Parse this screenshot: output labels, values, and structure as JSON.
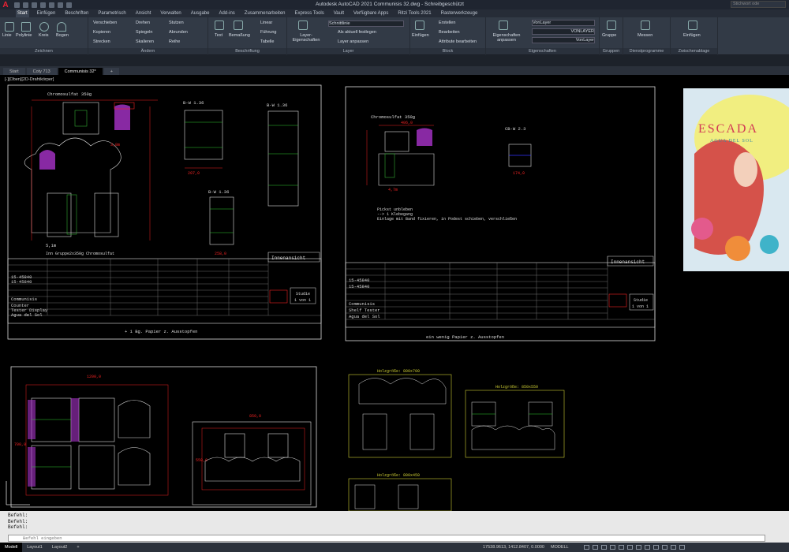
{
  "app": {
    "logo": "A",
    "title": "Autodesk AutoCAD 2021   Communisis 32.dwg - Schreibgeschützt",
    "search_placeholder": "Stichwort ode"
  },
  "ribbon_tabs": [
    "Start",
    "Einfügen",
    "Beschriften",
    "Parametrisch",
    "Ansicht",
    "Verwalten",
    "Ausgabe",
    "Add-ins",
    "Zusammenarbeiten",
    "Express Tools",
    "Vault",
    "Verfügbare Apps",
    "Ritzi Tools 2021",
    "Rasterwerkzeuge"
  ],
  "active_tab": "Start",
  "panels": {
    "zeichnen": {
      "title": "Zeichnen",
      "tools": [
        "Linie",
        "Polylinie",
        "Kreis",
        "Bogen"
      ]
    },
    "aendern": {
      "title": "Ändern",
      "tools": [
        "Verschieben",
        "Drehen",
        "Stutzen",
        "Kopieren",
        "Spiegeln",
        "Abrunden",
        "Strecken",
        "Skalieren",
        "Reihe"
      ]
    },
    "beschriftung": {
      "title": "Beschriftung",
      "tools": [
        "Text",
        "Bemaßung",
        "Linear",
        "Führung",
        "Tabelle"
      ]
    },
    "layer": {
      "title": "Layer",
      "tools": [
        "Layer-Eigenschaften",
        "Schnittlinie",
        "Als aktuell festlegen",
        "Layer anpassen"
      ]
    },
    "block": {
      "title": "Block",
      "tools": [
        "Einfügen",
        "Erstellen",
        "Bearbeiten",
        "Attribute bearbeiten"
      ]
    },
    "eigenschaften": {
      "title": "Eigenschaften",
      "tools": [
        "Eigenschaften anpassen",
        "VonLayer",
        "VONLAYER",
        "VonLayer"
      ]
    },
    "gruppen": {
      "title": "Gruppen",
      "tools": [
        "Gruppe"
      ]
    },
    "dienst": {
      "title": "Dienstprogramme",
      "tools": [
        "Messen"
      ]
    },
    "zwischen": {
      "title": "Zwischenablage",
      "tools": [
        "Einfügen"
      ]
    }
  },
  "doc_tabs": [
    "Start",
    "Coty 713",
    "Communisis 32*"
  ],
  "active_doc_tab": "Communisis 32*",
  "view_label": "[-][Oben][2D-Drahtkörper]",
  "drawing": {
    "sheet1": {
      "title": "Chromosulfat 350g",
      "label_bw1": "B-W 1.36",
      "label_bw2": "B-W 1.36",
      "label_bw3": "B-W 1.36",
      "dim_1": "3,8m",
      "dim_2": "5,1m",
      "dim_w": "207,0",
      "dim_w2": "258,0",
      "footer": "Inn Gruppe2x350g Chromosulfat",
      "view_title": "Innenansicht",
      "study": "Studie",
      "study_no": "1 von 1",
      "note": "+ 1 Bg. Papier z. Ausstopfen",
      "client_rows": [
        "15-45840",
        "15-45840",
        "Communisis",
        "Counter",
        "Tester Display",
        "Agua del Sol"
      ]
    },
    "sheet2": {
      "title": "Chromosulfat 350g",
      "label_cw": "CB-W 2.3",
      "dim_1": "4,7m",
      "dim_w": "406,0",
      "dim_w2": "174,0",
      "note1": "Pickst unbleben",
      "note2": "--> 1 Klebegang",
      "note3": "Einlage mit Band fixieren, in Podest schieben, verschließen",
      "view_title": "Innenansicht",
      "study": "Studie",
      "study_no": "1 von 1",
      "footer": "ein wenig Papier z. Ausstopfen",
      "client_rows": [
        "15-45840",
        "15-45840",
        "Communisis",
        "Shelf Tester",
        "Agua del Sol"
      ]
    },
    "layout3": {
      "dim_top": "1200,0",
      "dim_right": "700,0"
    },
    "layout4": {
      "dim_top": "850,0",
      "dim_left": "550,0"
    },
    "layout5": {
      "title": "Holzgröße: 800x700"
    },
    "layout6": {
      "title": "Holzgröße: 850x550"
    },
    "layout7": {
      "title": "Holzgröße: 800x450"
    },
    "image": {
      "brand": "ESCADA",
      "sub": "AGUA DEL SOL"
    }
  },
  "command": {
    "history": [
      "Befehl:",
      "Befehl:",
      "Befehl:"
    ],
    "prompt": "Befehl eingeben"
  },
  "status": {
    "tabs": [
      "Modell",
      "Layout1",
      "Layout2"
    ],
    "coords": "17538.9613, 1412.8407, 0.0000",
    "mode": "MODELL"
  }
}
